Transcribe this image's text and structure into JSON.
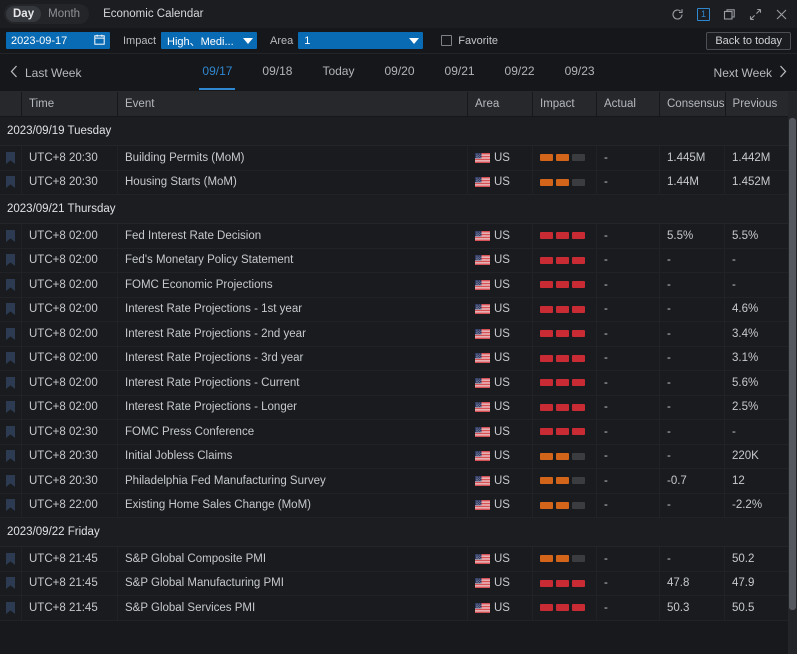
{
  "titlebar": {
    "tabs": [
      {
        "label": "Day",
        "active": true
      },
      {
        "label": "Month",
        "active": false
      }
    ],
    "app_title": "Economic Calendar",
    "controls": [
      {
        "name": "refresh-icon",
        "label": "refresh"
      },
      {
        "name": "window-count-badge",
        "label": "1"
      },
      {
        "name": "restore-window-icon",
        "label": "restore"
      },
      {
        "name": "expand-icon",
        "label": "expand"
      },
      {
        "name": "close-icon",
        "label": "close"
      }
    ]
  },
  "filterbar": {
    "date_value": "2023-09-17",
    "calendar_icon": "calendar-icon",
    "impact_label": "Impact",
    "impact_value": "High、Medi...",
    "area_label": "Area",
    "area_value": "1",
    "favorite_label": "Favorite",
    "favorite_checked": false,
    "back_to_today": "Back to today"
  },
  "daynav": {
    "prev_label": "Last Week",
    "next_label": "Next Week",
    "days": [
      {
        "label": "09/17",
        "active": true
      },
      {
        "label": "09/18",
        "active": false
      },
      {
        "label": "Today",
        "active": false
      },
      {
        "label": "09/20",
        "active": false
      },
      {
        "label": "09/21",
        "active": false
      },
      {
        "label": "09/22",
        "active": false
      },
      {
        "label": "09/23",
        "active": false
      }
    ]
  },
  "table": {
    "columns": [
      "",
      "Time",
      "Event",
      "Area",
      "Impact",
      "Actual",
      "Consensus",
      "Previous"
    ],
    "sections": [
      {
        "title": "2023/09/19 Tuesday",
        "rows": [
          {
            "time": "UTC+8 20:30",
            "event": "Building Permits (MoM)",
            "area": "US",
            "impact": "medium",
            "actual": "-",
            "consensus": "1.445M",
            "previous": "1.442M"
          },
          {
            "time": "UTC+8 20:30",
            "event": "Housing Starts (MoM)",
            "area": "US",
            "impact": "medium",
            "actual": "-",
            "consensus": "1.44M",
            "previous": "1.452M"
          }
        ]
      },
      {
        "title": "2023/09/21 Thursday",
        "rows": [
          {
            "time": "UTC+8 02:00",
            "event": "Fed Interest Rate Decision",
            "area": "US",
            "impact": "high",
            "actual": "-",
            "consensus": "5.5%",
            "previous": "5.5%"
          },
          {
            "time": "UTC+8 02:00",
            "event": "Fed's Monetary Policy Statement",
            "area": "US",
            "impact": "high",
            "actual": "-",
            "consensus": "-",
            "previous": "-"
          },
          {
            "time": "UTC+8 02:00",
            "event": "FOMC Economic Projections",
            "area": "US",
            "impact": "high",
            "actual": "-",
            "consensus": "-",
            "previous": "-"
          },
          {
            "time": "UTC+8 02:00",
            "event": "Interest Rate Projections - 1st year",
            "area": "US",
            "impact": "high",
            "actual": "-",
            "consensus": "-",
            "previous": "4.6%"
          },
          {
            "time": "UTC+8 02:00",
            "event": "Interest Rate Projections - 2nd year",
            "area": "US",
            "impact": "high",
            "actual": "-",
            "consensus": "-",
            "previous": "3.4%"
          },
          {
            "time": "UTC+8 02:00",
            "event": "Interest Rate Projections - 3rd year",
            "area": "US",
            "impact": "high",
            "actual": "-",
            "consensus": "-",
            "previous": "3.1%"
          },
          {
            "time": "UTC+8 02:00",
            "event": "Interest Rate Projections - Current",
            "area": "US",
            "impact": "high",
            "actual": "-",
            "consensus": "-",
            "previous": "5.6%"
          },
          {
            "time": "UTC+8 02:00",
            "event": "Interest Rate Projections - Longer",
            "area": "US",
            "impact": "high",
            "actual": "-",
            "consensus": "-",
            "previous": "2.5%"
          },
          {
            "time": "UTC+8 02:30",
            "event": "FOMC Press Conference",
            "area": "US",
            "impact": "high",
            "actual": "-",
            "consensus": "-",
            "previous": "-"
          },
          {
            "time": "UTC+8 20:30",
            "event": "Initial Jobless Claims",
            "area": "US",
            "impact": "medium",
            "actual": "-",
            "consensus": "-",
            "previous": "220K"
          },
          {
            "time": "UTC+8 20:30",
            "event": "Philadelphia Fed Manufacturing Survey",
            "area": "US",
            "impact": "medium",
            "actual": "-",
            "consensus": "-0.7",
            "previous": "12"
          },
          {
            "time": "UTC+8 22:00",
            "event": "Existing Home Sales Change (MoM)",
            "area": "US",
            "impact": "medium",
            "actual": "-",
            "consensus": "-",
            "previous": "-2.2%"
          }
        ]
      },
      {
        "title": "2023/09/22 Friday",
        "rows": [
          {
            "time": "UTC+8 21:45",
            "event": "S&P Global Composite PMI",
            "area": "US",
            "impact": "medium",
            "actual": "-",
            "consensus": "-",
            "previous": "50.2"
          },
          {
            "time": "UTC+8 21:45",
            "event": "S&P Global Manufacturing PMI",
            "area": "US",
            "impact": "high",
            "actual": "-",
            "consensus": "47.8",
            "previous": "47.9"
          },
          {
            "time": "UTC+8 21:45",
            "event": "S&P Global Services PMI",
            "area": "US",
            "impact": "high",
            "actual": "-",
            "consensus": "50.3",
            "previous": "50.5"
          }
        ]
      }
    ]
  },
  "colors": {
    "accent_blue": "#0a6bb5",
    "link_blue": "#2f87d0",
    "impact_high": "#c92b34",
    "impact_medium": "#d3651a",
    "impact_empty": "#3a3c40",
    "background": "#16171a"
  }
}
